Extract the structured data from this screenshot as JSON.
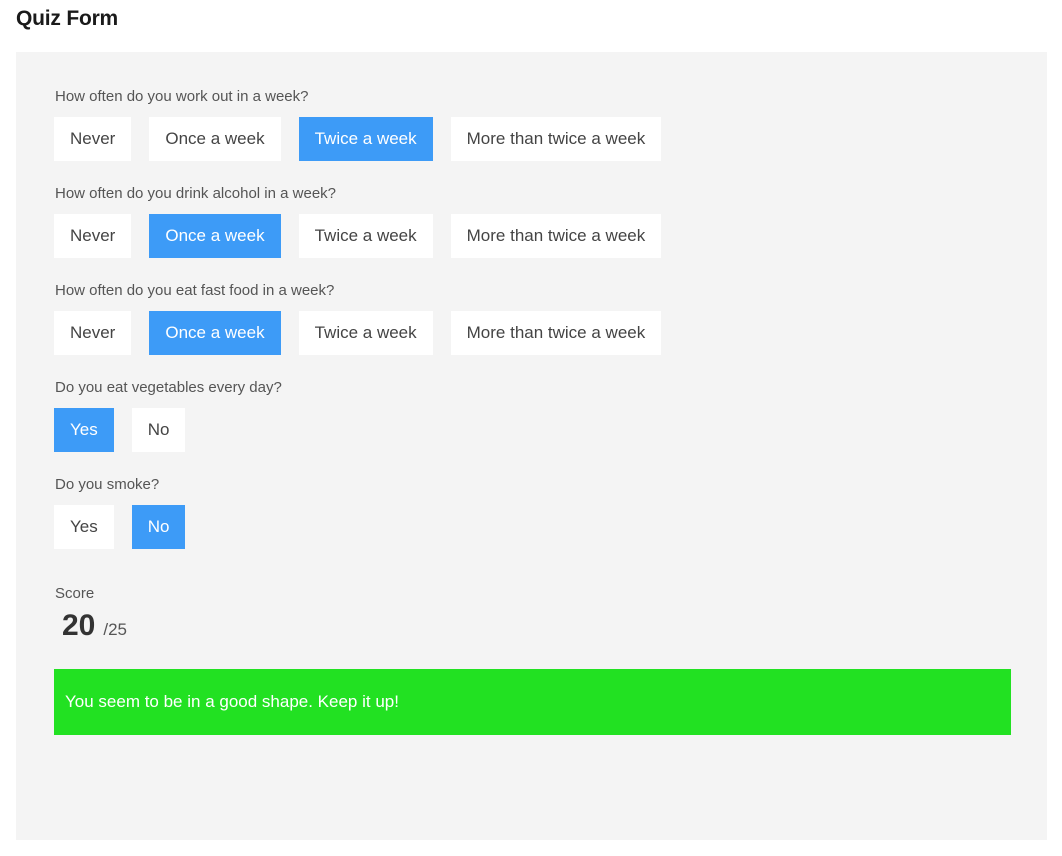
{
  "page": {
    "title": "Quiz Form"
  },
  "questions": [
    {
      "label": "How often do you work out in a week?",
      "options": [
        "Never",
        "Once a week",
        "Twice a week",
        "More than twice a week"
      ],
      "selected": "Twice a week"
    },
    {
      "label": "How often do you drink alcohol in a week?",
      "options": [
        "Never",
        "Once a week",
        "Twice a week",
        "More than twice a week"
      ],
      "selected": "Once a week"
    },
    {
      "label": "How often do you eat fast food in a week?",
      "options": [
        "Never",
        "Once a week",
        "Twice a week",
        "More than twice a week"
      ],
      "selected": "Once a week"
    },
    {
      "label": "Do you eat vegetables every day?",
      "options": [
        "Yes",
        "No"
      ],
      "selected": "Yes"
    },
    {
      "label": "Do you smoke?",
      "options": [
        "Yes",
        "No"
      ],
      "selected": "No"
    }
  ],
  "score": {
    "label": "Score",
    "value": "20",
    "total": "/25"
  },
  "result": {
    "message": "You seem to be in a good shape. Keep it up!"
  },
  "colors": {
    "selected_blue": "#3d9bf7",
    "result_green": "#22e122",
    "panel_gray": "#f4f4f4",
    "label_gray": "#555555"
  }
}
